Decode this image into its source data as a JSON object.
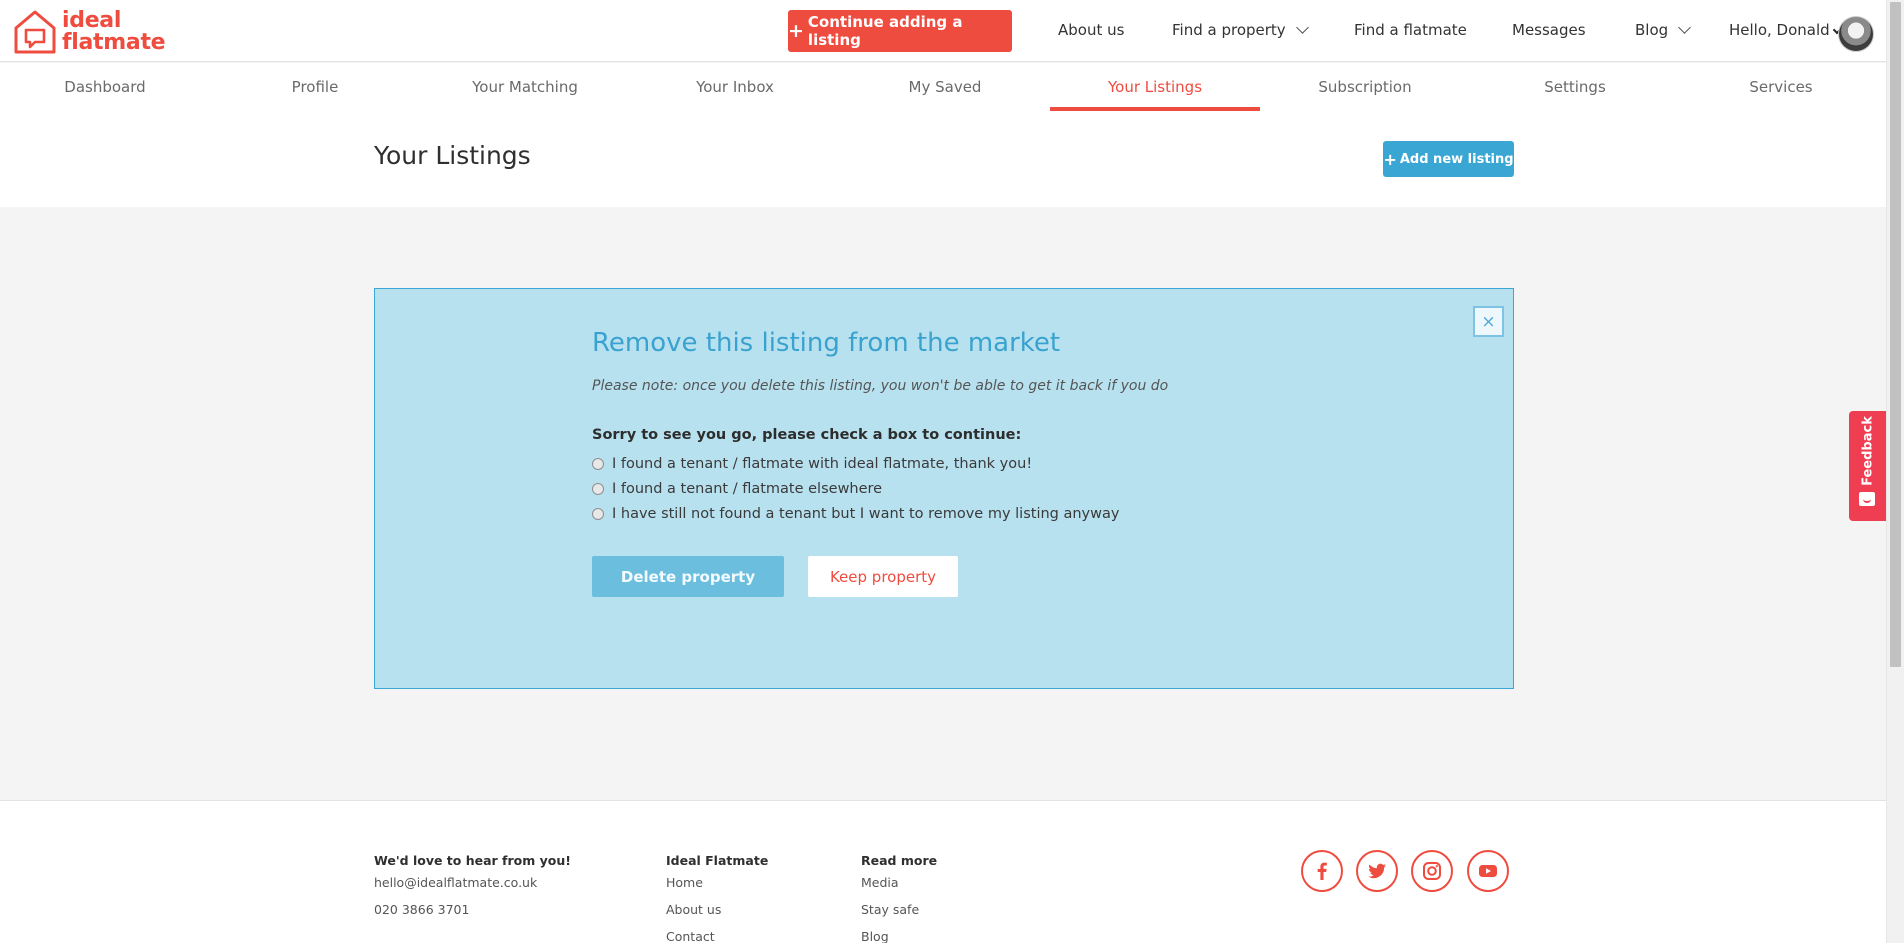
{
  "header": {
    "logo_line1": "ideal",
    "logo_line2": "flatmate",
    "cta_label": "Continue adding a listing",
    "nav": {
      "about": "About us",
      "find_property": "Find a property",
      "find_flatmate": "Find a flatmate",
      "messages": "Messages",
      "blog": "Blog",
      "greeting": "Hello, Donald"
    }
  },
  "subnav": {
    "items": [
      "Dashboard",
      "Profile",
      "Your Matching",
      "Your Inbox",
      "My Saved",
      "Your Listings",
      "Subscription",
      "Settings",
      "Services"
    ],
    "active": "Your Listings"
  },
  "page": {
    "title": "Your Listings",
    "add_button": "Add new listing"
  },
  "modal": {
    "close_symbol": "×",
    "title": "Remove this listing from the market",
    "note": "Please note: once you delete this listing, you won't be able to get it back if you do",
    "question": "Sorry to see you go, please check a box to continue:",
    "options": [
      "I found a tenant / flatmate with ideal flatmate, thank you!",
      "I found a tenant / flatmate elsewhere",
      "I have still not found a tenant but I want to remove my listing anyway"
    ],
    "delete_label": "Delete property",
    "keep_label": "Keep property"
  },
  "feedback": {
    "label": "Feedback"
  },
  "footer": {
    "contact": {
      "title": "We'd love to hear from you!",
      "email": "hello@idealflatmate.co.uk",
      "phone": "020 3866 3701"
    },
    "ideal_flatmate": {
      "title": "Ideal Flatmate",
      "links": [
        "Home",
        "About us",
        "Contact"
      ]
    },
    "read_more": {
      "title": "Read more",
      "links": [
        "Media",
        "Stay safe",
        "Blog"
      ]
    },
    "social": [
      "facebook-icon",
      "twitter-icon",
      "instagram-icon",
      "youtube-icon"
    ]
  },
  "colors": {
    "brand_red": "#ef4c40",
    "accent_blue": "#39a6d4",
    "panel_bg": "#b8e1f0",
    "feedback_red": "#ef3d52"
  }
}
